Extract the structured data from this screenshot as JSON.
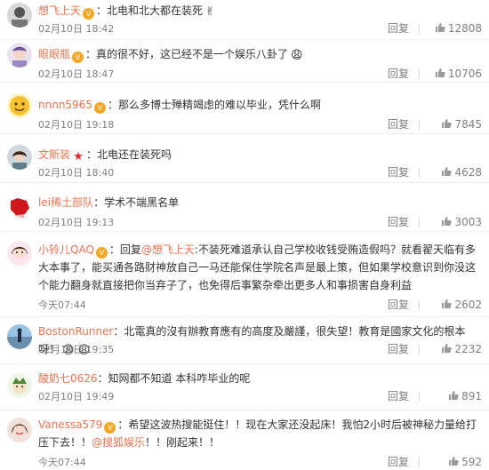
{
  "reply_label": "回复",
  "comments": [
    {
      "user": "想飞上天",
      "text": "：北电和北大都在装死",
      "emoji": "✌",
      "time": "02月10日 18:42",
      "likes": "12808"
    },
    {
      "user": "眼眼瓶",
      "text": "：真的很不好，这已经不是一个娱乐八卦了",
      "emoji": "😩",
      "time": "02月10日 18:47",
      "likes": "10706"
    },
    {
      "user": "nnnn5965",
      "text": "：那么多博士殚精竭虑的难以毕业，凭什么啊",
      "time": "02月10日 19:18",
      "likes": "7845"
    },
    {
      "user": "文斯装",
      "text": "：北电还在装死吗",
      "time": "02月10日 18:40",
      "likes": "4628"
    },
    {
      "user": "lei稀土部队",
      "text": "：学术不端黑名单",
      "time": "02月10日 19:13",
      "likes": "3003"
    },
    {
      "user": "小铃儿QAQ",
      "text_before": "：回复",
      "mention": "@想飞上天",
      "text": ":不装死难道承认自己学校收钱受贿造假吗？就看翟天临有多大本事了，能买通各路财神放自己一马还能保住学院名声是最上策，但如果学校意识到你没这个能力翻身就直接把你当弃子了，也免得后事繁杂牵出更多人和事损害自身利益",
      "time": "今天07:44",
      "likes": "2602"
    },
    {
      "user": "BostonRunner",
      "text": "：北電真的沒有辦教育應有的高度及嚴謹，很失望！教育是國家文化的根本呀！",
      "emoji": "😩 😩",
      "time": "02月10日 19:35",
      "likes": "2232"
    },
    {
      "user": "酸奶七0626",
      "text": "：知网都不知道 本科咋毕业的呢",
      "time": "02月10日 19:49",
      "likes": "891"
    },
    {
      "user": "Vanessa579",
      "text": "：希望这波热搜能挺住！！现在大家还没起床！我怕2小时后被神秘力量给打压下去！！",
      "mention": "@搜狐娱乐",
      "text_after": "！！刚起来！！",
      "time": "今天07:44",
      "likes": "592"
    }
  ]
}
